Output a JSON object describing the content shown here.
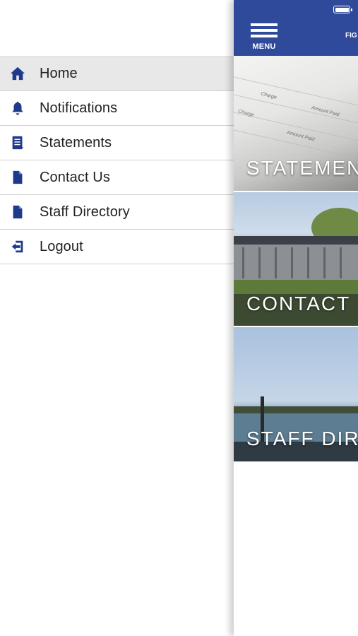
{
  "drawer": {
    "items": [
      {
        "label": "Home",
        "icon": "home-icon"
      },
      {
        "label": "Notifications",
        "icon": "bell-icon"
      },
      {
        "label": "Statements",
        "icon": "statement-icon"
      },
      {
        "label": "Contact Us",
        "icon": "document-icon"
      },
      {
        "label": "Staff Directory",
        "icon": "document-icon"
      },
      {
        "label": "Logout",
        "icon": "logout-icon"
      }
    ],
    "active_index": 0
  },
  "header": {
    "menu_label": "MENU",
    "title": "FIG"
  },
  "tiles": [
    {
      "label": "STATEMEN"
    },
    {
      "label": "CONTACT"
    },
    {
      "label": "STAFF DIR"
    }
  ],
  "colors": {
    "brand": "#2f4a9a",
    "icon": "#1f3a8a"
  }
}
